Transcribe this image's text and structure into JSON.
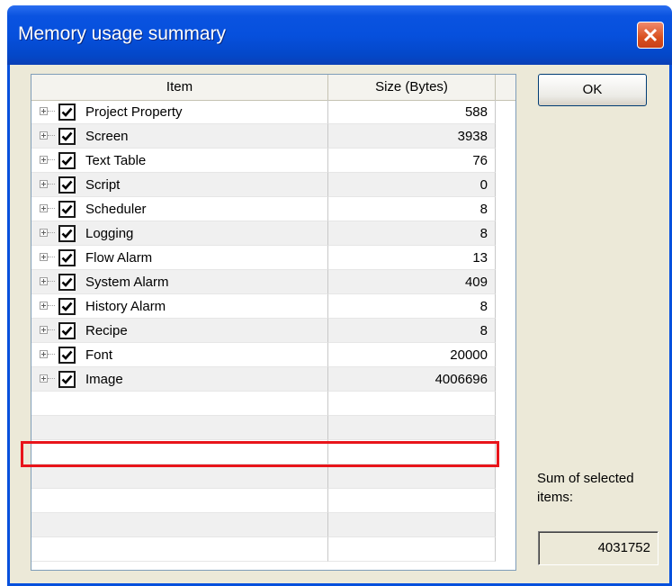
{
  "window": {
    "title": "Memory usage summary"
  },
  "list": {
    "columns": [
      "Item",
      "Size (Bytes)"
    ],
    "rows": [
      {
        "label": "Project Property",
        "size": "588",
        "checked": true
      },
      {
        "label": "Screen",
        "size": "3938",
        "checked": true
      },
      {
        "label": "Text Table",
        "size": "76",
        "checked": true
      },
      {
        "label": "Script",
        "size": "0",
        "checked": true
      },
      {
        "label": "Scheduler",
        "size": "8",
        "checked": true
      },
      {
        "label": "Logging",
        "size": "8",
        "checked": true
      },
      {
        "label": "Flow Alarm",
        "size": "13",
        "checked": true
      },
      {
        "label": "System Alarm",
        "size": "409",
        "checked": true
      },
      {
        "label": "History Alarm",
        "size": "8",
        "checked": true
      },
      {
        "label": "Recipe",
        "size": "8",
        "checked": true
      },
      {
        "label": "Font",
        "size": "20000",
        "checked": true
      },
      {
        "label": "Image",
        "size": "4006696",
        "checked": true,
        "highlighted": true
      }
    ],
    "empty_rows": 7
  },
  "buttons": {
    "ok": "OK"
  },
  "summary": {
    "label": "Sum of selected items:",
    "value": "4031752"
  },
  "colors": {
    "highlight": "#e8141a",
    "titlebar": "#0650dd",
    "dialog_bg": "#ece9d8"
  }
}
